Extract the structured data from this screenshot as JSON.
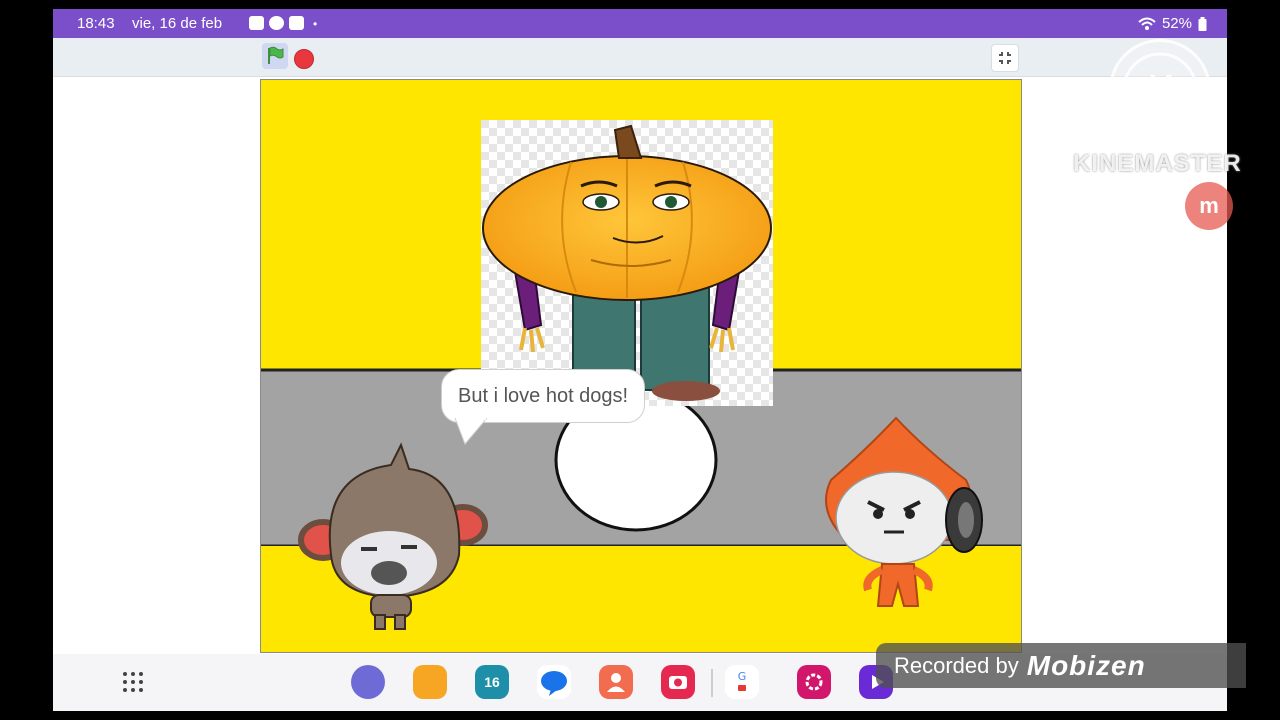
{
  "status_bar": {
    "time": "18:43",
    "date": "vie, 16 de feb",
    "battery": "52%",
    "bar_color": "#7b4fc9"
  },
  "toolbar": {
    "green_flag_icon": "green-flag-icon",
    "stop_icon": "stop-icon",
    "fullscreen_icon": "exit-fullscreen-icon"
  },
  "stage": {
    "speech_bubble": "But i love hot dogs!",
    "background_colors": {
      "yellow": "#ffe600",
      "gray": "#a3a3a3"
    }
  },
  "overlay": {
    "kinemaster_text": "KINEMASTER",
    "kinemaster_logo": "K",
    "kinemaster_badge": "m",
    "recorded_by": "Recorded by",
    "recorder_brand": "Mobizen"
  },
  "dock": {
    "apps": [
      "all-apps-icon",
      "internet-icon",
      "files-icon",
      "calendar-icon",
      "messages-icon",
      "contacts-icon",
      "camera-icon",
      "google-icon",
      "gallery-icon",
      "play-icon"
    ],
    "calendar_day": "16"
  }
}
